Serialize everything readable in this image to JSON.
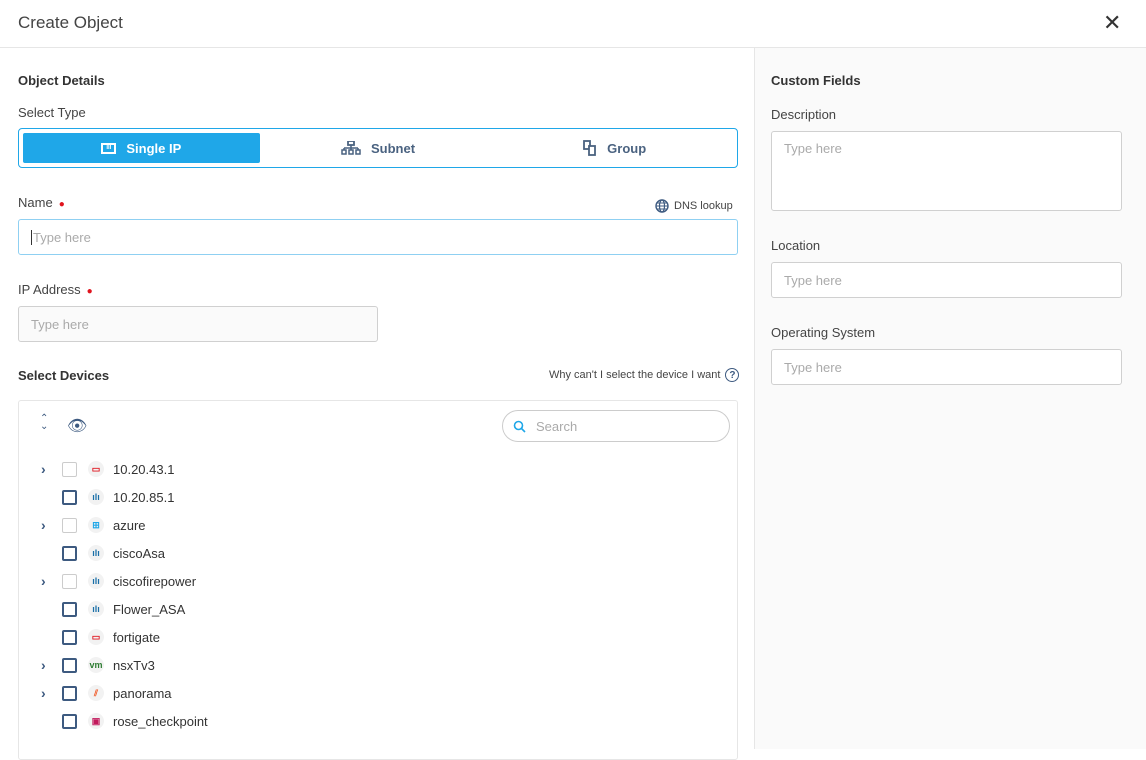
{
  "dialog": {
    "title": "Create Object",
    "close_icon": "close-icon"
  },
  "details": {
    "section_title": "Object Details",
    "select_type_label": "Select Type",
    "types": [
      {
        "label": "Single IP",
        "icon": "single-ip-icon",
        "selected": true
      },
      {
        "label": "Subnet",
        "icon": "subnet-icon",
        "selected": false
      },
      {
        "label": "Group",
        "icon": "group-icon",
        "selected": false
      }
    ],
    "name_label": "Name",
    "name_placeholder": "Type here",
    "dns_lookup": "DNS lookup",
    "ip_label": "IP Address",
    "ip_placeholder": "Type here",
    "devices_label": "Select Devices",
    "devices_help": "Why can't I select the device I want",
    "search_placeholder": "Search",
    "devices": [
      {
        "name": "10.20.43.1",
        "vendor": "fortinet",
        "expandable": true,
        "disabled": true
      },
      {
        "name": "10.20.85.1",
        "vendor": "cisco",
        "expandable": false,
        "disabled": false
      },
      {
        "name": "azure",
        "vendor": "azure",
        "expandable": true,
        "disabled": true
      },
      {
        "name": "ciscoAsa",
        "vendor": "cisco",
        "expandable": false,
        "disabled": false
      },
      {
        "name": "ciscofirepower",
        "vendor": "cisco",
        "expandable": true,
        "disabled": true
      },
      {
        "name": "Flower_ASA",
        "vendor": "cisco",
        "expandable": false,
        "disabled": false
      },
      {
        "name": "fortigate",
        "vendor": "fortinet",
        "expandable": false,
        "disabled": false
      },
      {
        "name": "nsxTv3",
        "vendor": "vmware",
        "expandable": true,
        "disabled": false
      },
      {
        "name": "panorama",
        "vendor": "paloalto",
        "expandable": true,
        "disabled": false
      },
      {
        "name": "rose_checkpoint",
        "vendor": "checkpoint",
        "expandable": false,
        "disabled": false
      }
    ]
  },
  "custom": {
    "section_title": "Custom Fields",
    "description_label": "Description",
    "description_placeholder": "Type here",
    "location_label": "Location",
    "location_placeholder": "Type here",
    "os_label": "Operating System",
    "os_placeholder": "Type here"
  },
  "colors": {
    "accent": "#1fa7e8",
    "required": "#e0141e",
    "icon": "#3d5a80"
  }
}
